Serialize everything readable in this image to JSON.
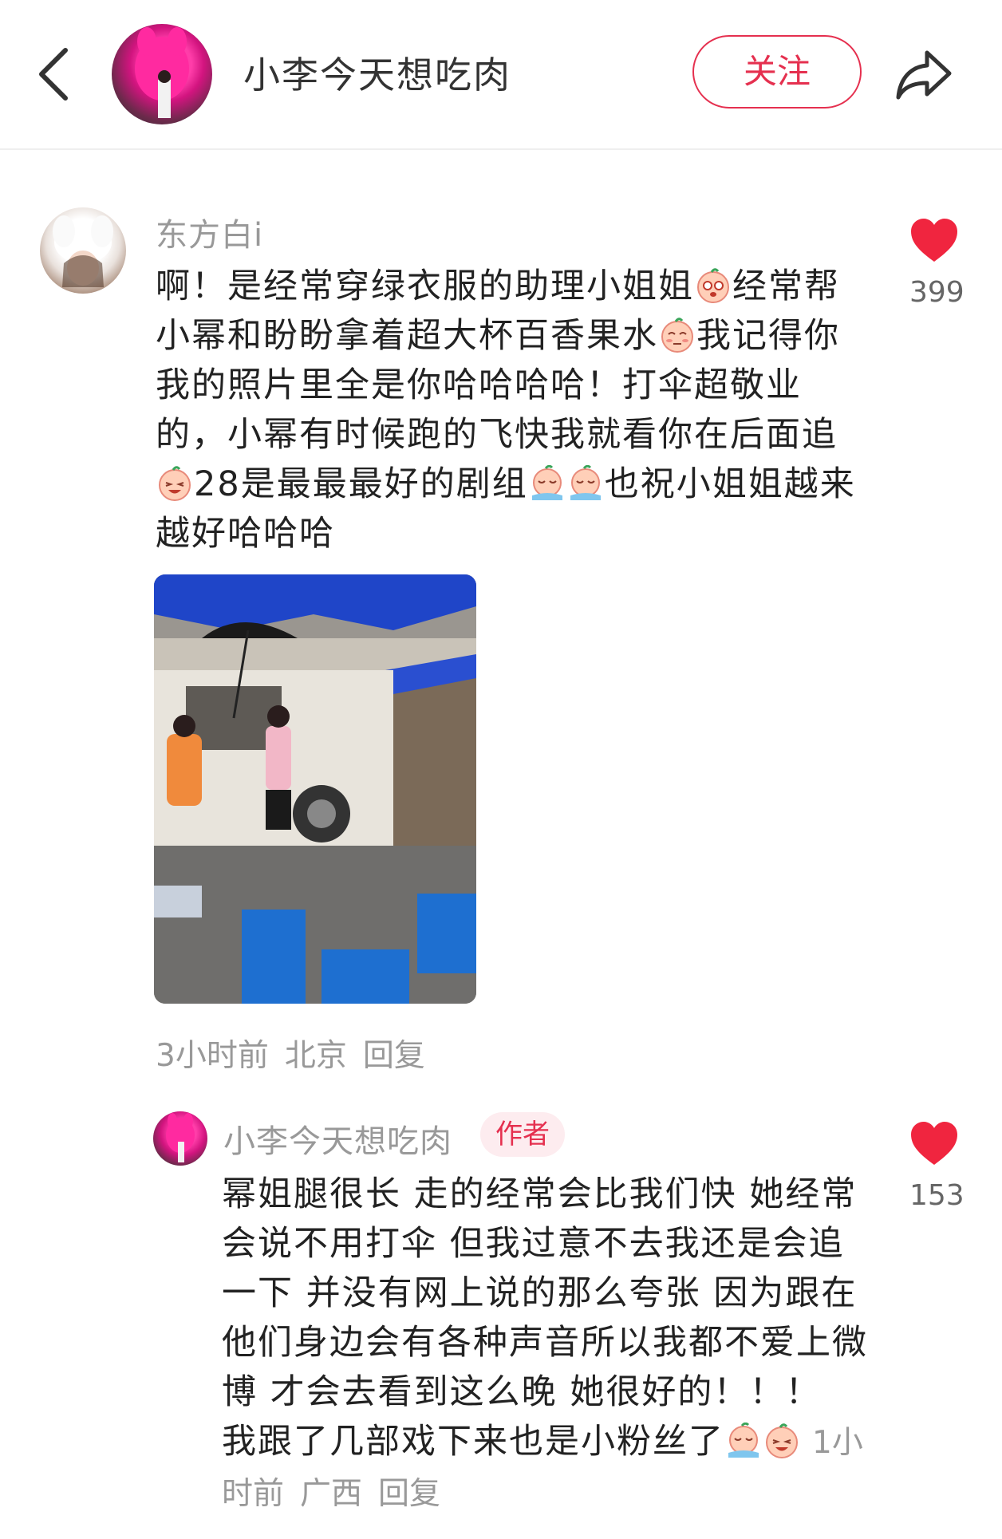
{
  "header": {
    "title": "小李今天想吃肉",
    "follow_label": "关注"
  },
  "comments": [
    {
      "user": "东方白i",
      "text_parts": [
        "啊！是经常穿绿衣服的助理小姐姐",
        "经常帮小幂和盼盼拿着超大杯百香果水",
        "我记得你 我的照片里全是你哈哈哈哈！打伞超敬业的，小幂有时候跑的飞快我就看你在后面追",
        "28是最最最好的剧组",
        "也祝小姐姐越来越好哈哈哈"
      ],
      "time": "3小时前",
      "location": "北京",
      "reply_label": "回复",
      "likes": "399"
    },
    {
      "user": "小李今天想吃肉",
      "badge": "作者",
      "text": "幂姐腿很长 走的经常会比我们快 她经常会说不用打伞 但我过意不去我还是会追一下 并没有网上说的那么夸张 因为跟在他们身边会有各种声音所以我都不爱上微博 才会去看到这么晚 她很好的！！！ 我跟了几部戏下来也是小粉丝了",
      "time": "1小时前",
      "location": "广西",
      "reply_label": "回复",
      "likes": "153"
    }
  ],
  "colors": {
    "accent": "#e5304f",
    "muted_text": "#999999",
    "body_text": "#222222"
  }
}
